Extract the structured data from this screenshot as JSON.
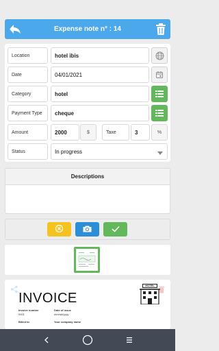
{
  "header": {
    "title": "Expense note n° : 14"
  },
  "form": {
    "location": {
      "label": "Location",
      "value": "hotel ibis"
    },
    "date": {
      "label": "Date",
      "value": "04/01/2021"
    },
    "category": {
      "label": "Category",
      "value": "hotel"
    },
    "payment": {
      "label": "Payment Type",
      "value": "cheque"
    },
    "amount": {
      "label": "Amount",
      "value": "2000",
      "unit": "$"
    },
    "tax": {
      "label": "Taxe",
      "value": "3",
      "unit": "%"
    },
    "status": {
      "label": "Status",
      "value": "In progress"
    }
  },
  "descriptions": {
    "title": "Descriptions",
    "value": ""
  },
  "colors": {
    "header": "#4ba8ea",
    "green": "#62b85a",
    "yellow": "#f5c320",
    "blue": "#2a8fd6"
  },
  "invoice_preview": {
    "title": "INVOICE",
    "invoice_number_label": "Invoice number",
    "invoice_number": "0001",
    "date_label": "Date of issue",
    "date": "mm/dd/yyyy",
    "billed_to_label": "Billed to",
    "company_label": "Your company name",
    "hotel_label": "HOTEL"
  }
}
